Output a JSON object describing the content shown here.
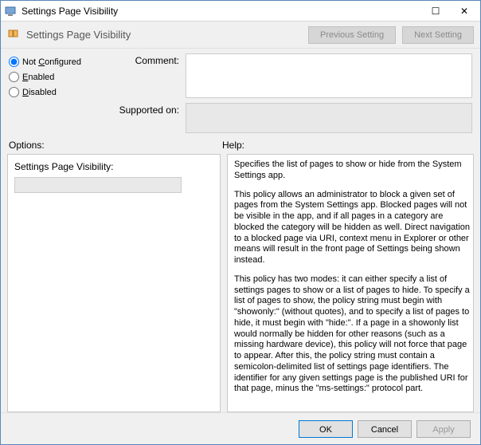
{
  "title": "Settings Page Visibility",
  "header": {
    "label": "Settings Page Visibility",
    "prev_button": "Previous Setting",
    "next_button": "Next Setting"
  },
  "radios": {
    "not_configured": "Not Configured",
    "enabled": "Enabled",
    "disabled": "Disabled"
  },
  "fields": {
    "comment_label": "Comment:",
    "comment_value": "",
    "supported_label": "Supported on:",
    "supported_value": ""
  },
  "sections": {
    "options_label": "Options:",
    "help_label": "Help:"
  },
  "options": {
    "visibility_label": "Settings Page Visibility:",
    "visibility_value": ""
  },
  "help": {
    "p1": "Specifies the list of pages to show or hide from the System Settings app.",
    "p2": "This policy allows an administrator to block a given set of pages from the System Settings app. Blocked pages will not be visible in the app, and if all pages in a category are blocked the category will be hidden as well. Direct navigation to a blocked page via URI, context menu in Explorer or other means will result in the front page of Settings being shown instead.",
    "p3": "This policy has two modes: it can either specify a list of settings pages to show or a list of pages to hide. To specify a list of pages to show, the policy string must begin with \"showonly:\" (without quotes), and to specify a list of pages to hide, it must begin with \"hide:\". If a page in a showonly list would normally be hidden for other reasons (such as a missing hardware device), this policy will not force that page to appear. After this, the policy string must contain a semicolon-delimited list of settings page identifiers. The identifier for any given settings page is the published URI for that page, minus the \"ms-settings:\" protocol part."
  },
  "footer": {
    "ok": "OK",
    "cancel": "Cancel",
    "apply": "Apply"
  }
}
